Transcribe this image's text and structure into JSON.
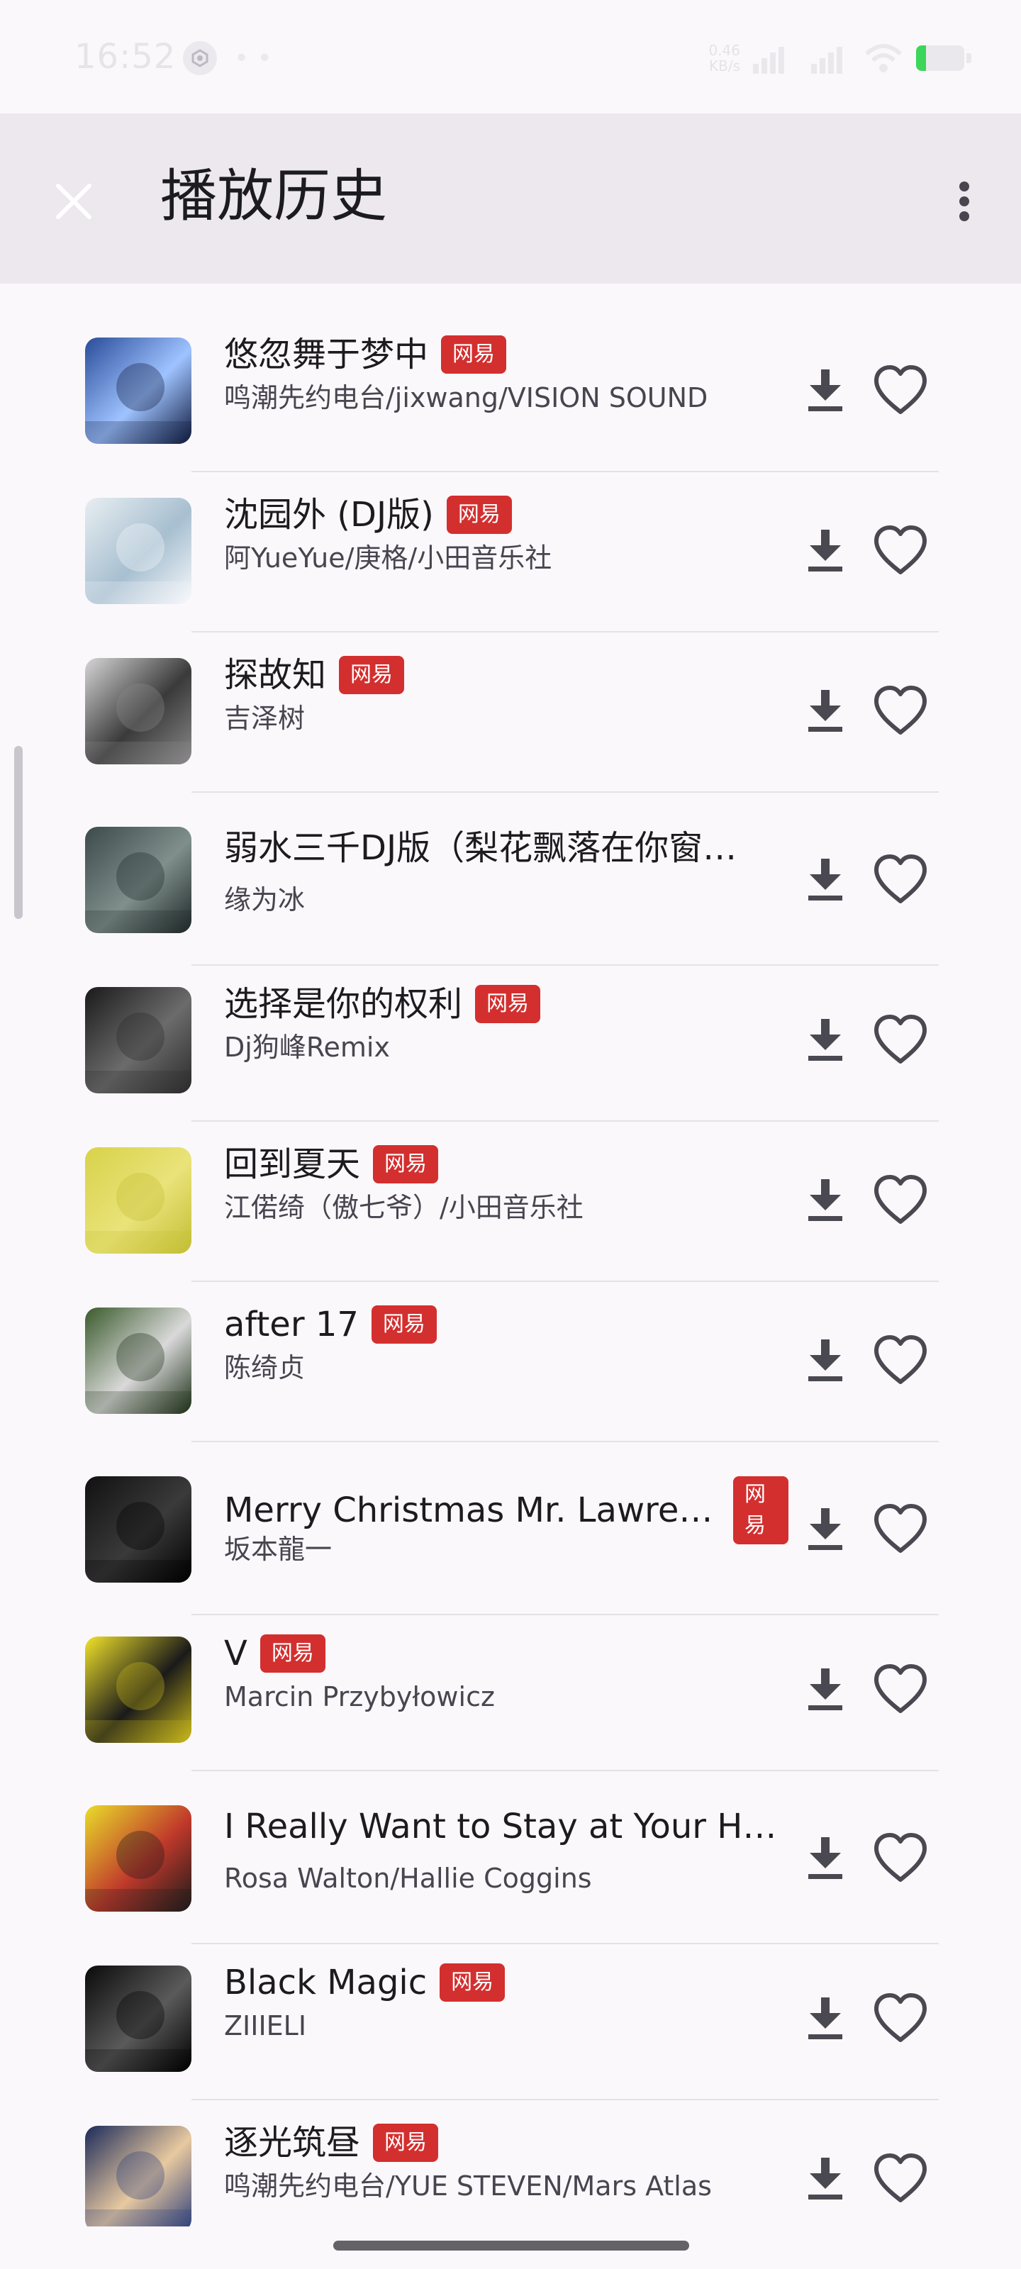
{
  "status_bar": {
    "time": "16:52",
    "notification_dots": "• •",
    "net_speed_value": "0.46",
    "net_speed_unit": "KB/s",
    "battery_color": "#3bd65a"
  },
  "app_bar": {
    "title": "播放历史",
    "close_icon": "close-icon",
    "more_icon": "more-vertical-icon"
  },
  "colors": {
    "badge": "#d32f2f",
    "background": "#fbf8fc",
    "app_bar": "#ece8ee"
  },
  "songs": [
    {
      "title": "悠忽舞于梦中",
      "artist": "鸣潮先约电台/jixwang/VISION SOUND",
      "badge": "网易"
    },
    {
      "title": "沈园外 (DJ版)",
      "artist": "阿YueYue/庚格/小田音乐社",
      "badge": "网易"
    },
    {
      "title": "探故知",
      "artist": "吉泽树",
      "badge": "网易"
    },
    {
      "title": "弱水三千DJ版（梨花飘落在你窗…",
      "artist": "缘为冰",
      "badge": ""
    },
    {
      "title": "选择是你的权利",
      "artist": "Dj狗峰Remix",
      "badge": "网易"
    },
    {
      "title": "回到夏天",
      "artist": "江偌绮（傲七爷）/小田音乐社",
      "badge": "网易"
    },
    {
      "title": "after 17",
      "artist": "陈绮贞",
      "badge": "网易"
    },
    {
      "title": "Merry Christmas Mr. Lawrence",
      "artist": "坂本龍一",
      "badge": "网易"
    },
    {
      "title": "V",
      "artist": "Marcin Przybyłowicz",
      "badge": "网易"
    },
    {
      "title": "I Really Want to Stay at Your House",
      "artist": "Rosa Walton/Hallie Coggins",
      "badge": ""
    },
    {
      "title": "Black Magic",
      "artist": "ZIIIELI",
      "badge": "网易"
    },
    {
      "title": "逐光筑昼",
      "artist": "鸣潮先约电台/YUE STEVEN/Mars Atlas",
      "badge": "网易"
    }
  ]
}
